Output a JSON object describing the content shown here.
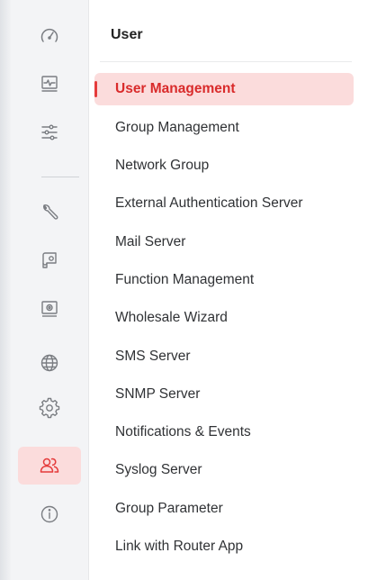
{
  "rail": {
    "icons": [
      {
        "name": "dashboard-gauge-icon"
      },
      {
        "name": "monitoring-icon"
      },
      {
        "name": "sliders-icon"
      },
      {
        "name": "wrench-icon"
      },
      {
        "name": "certificate-icon"
      },
      {
        "name": "diagnostics-icon"
      },
      {
        "name": "globe-icon"
      },
      {
        "name": "gear-icon"
      },
      {
        "name": "users-icon",
        "active": true
      },
      {
        "name": "info-icon"
      }
    ]
  },
  "panel": {
    "title": "User",
    "items": [
      {
        "label": "User Management",
        "active": true
      },
      {
        "label": "Group Management"
      },
      {
        "label": "Network Group"
      },
      {
        "label": "External Authentication Server"
      },
      {
        "label": "Mail Server"
      },
      {
        "label": "Function Management"
      },
      {
        "label": "Wholesale Wizard"
      },
      {
        "label": "SMS Server"
      },
      {
        "label": "SNMP Server"
      },
      {
        "label": "Notifications & Events"
      },
      {
        "label": "Syslog Server"
      },
      {
        "label": "Group Parameter"
      },
      {
        "label": "Link with Router App"
      }
    ]
  },
  "colors": {
    "accent": "#e53b3b",
    "active_bg": "#fbdcdc",
    "icon_gray": "#7a7d82"
  }
}
